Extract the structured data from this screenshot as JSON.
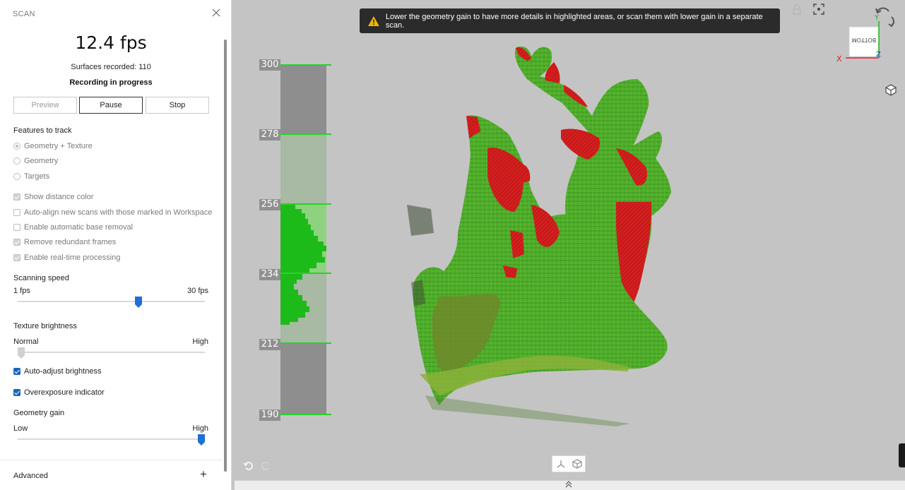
{
  "panel": {
    "title": "SCAN",
    "fps": "12.4 fps",
    "surfaces": "Surfaces recorded: 110",
    "status": "Recording in progress",
    "buttons": {
      "preview": "Preview",
      "pause": "Pause",
      "stop": "Stop"
    },
    "features_heading": "Features to track",
    "features": [
      {
        "label": "Geometry + Texture",
        "selected": true
      },
      {
        "label": "Geometry",
        "selected": false
      },
      {
        "label": "Targets",
        "selected": false
      }
    ],
    "options": [
      {
        "label": "Show distance color",
        "checked": true,
        "enabled": false
      },
      {
        "label": "Auto-align new scans with those marked in Workspace",
        "checked": false,
        "enabled": false
      },
      {
        "label": "Enable automatic base removal",
        "checked": false,
        "enabled": false
      },
      {
        "label": "Remove redundant frames",
        "checked": true,
        "enabled": false
      },
      {
        "label": "Enable real-time processing",
        "checked": true,
        "enabled": false
      }
    ],
    "scanning_speed": {
      "heading": "Scanning speed",
      "min_label": "1 fps",
      "max_label": "30 fps",
      "level": 0.65
    },
    "texture_brightness": {
      "heading": "Texture brightness",
      "min_label": "Normal",
      "max_label": "High",
      "level": 0.0
    },
    "auto_adjust": {
      "label": "Auto-adjust brightness",
      "checked": true
    },
    "overexposure": {
      "label": "Overexposure indicator",
      "checked": true
    },
    "geometry_gain": {
      "heading": "Geometry gain",
      "min_label": "Low",
      "max_label": "High",
      "level": 1.0
    },
    "advanced": "Advanced"
  },
  "warning": {
    "icon": "warning-icon",
    "text": "Lower the geometry gain to have more details in highlighted areas, or scan them with lower gain in a separate scan."
  },
  "depth_scale": {
    "labels": [
      "300",
      "278",
      "256",
      "234",
      "212",
      "190"
    ]
  },
  "view_cube": {
    "face_label": "BOTTOM",
    "axis_x": "X",
    "axis_y": "Y",
    "axis_z": "Z"
  },
  "colors": {
    "accent": "#1e6fd9",
    "scan_green": "#3aa820",
    "overexposed_red": "#d42020",
    "histogram_green": "#22c018"
  }
}
